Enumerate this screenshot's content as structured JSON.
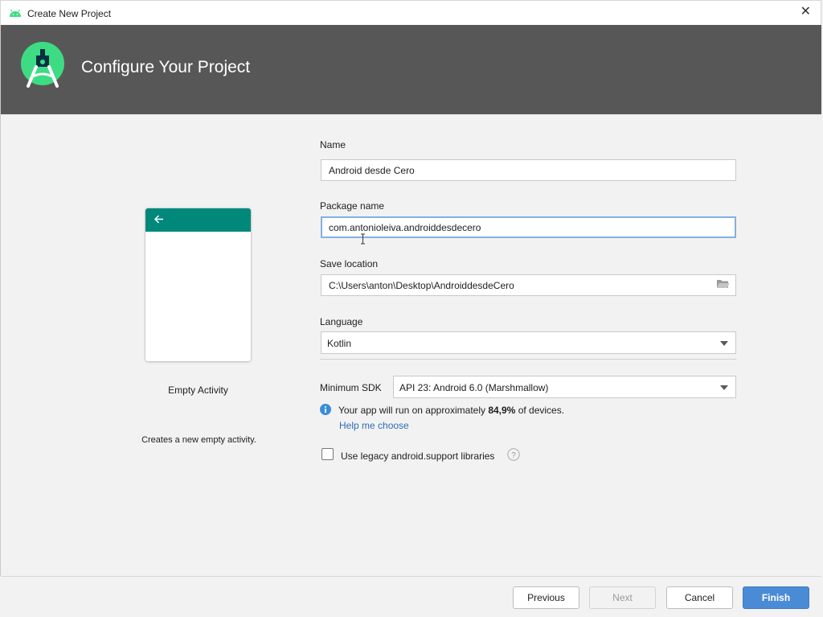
{
  "window": {
    "title": "Create New Project",
    "close_glyph": "✕"
  },
  "header": {
    "title": "Configure Your Project",
    "logo_icon": "android-studio-logo-icon"
  },
  "template": {
    "name": "Empty Activity",
    "description": "Creates a new empty activity.",
    "appbar_color": "#00897b"
  },
  "form": {
    "name_label": "Name",
    "name_value": "Android desde Cero",
    "package_label": "Package name",
    "package_value": "com.antonioleiva.androiddesdecero",
    "location_label": "Save location",
    "location_value": "C:\\Users\\anton\\Desktop\\AndroiddesdeCero",
    "language_label": "Language",
    "language_value": "Kotlin",
    "min_sdk_label": "Minimum SDK",
    "min_sdk_value": "API 23: Android 6.0 (Marshmallow)",
    "info_prefix": "Your app will run on approximately ",
    "info_percent": "84,9%",
    "info_suffix": " of devices.",
    "help_link": "Help me choose",
    "legacy_label": "Use legacy android.support libraries",
    "legacy_checked": false
  },
  "buttons": {
    "previous": "Previous",
    "next": "Next",
    "cancel": "Cancel",
    "finish": "Finish"
  },
  "colors": {
    "header_bg": "#575757",
    "accent": "#4a8bd6",
    "link": "#2d6db5",
    "android_green": "#3ddc84"
  }
}
